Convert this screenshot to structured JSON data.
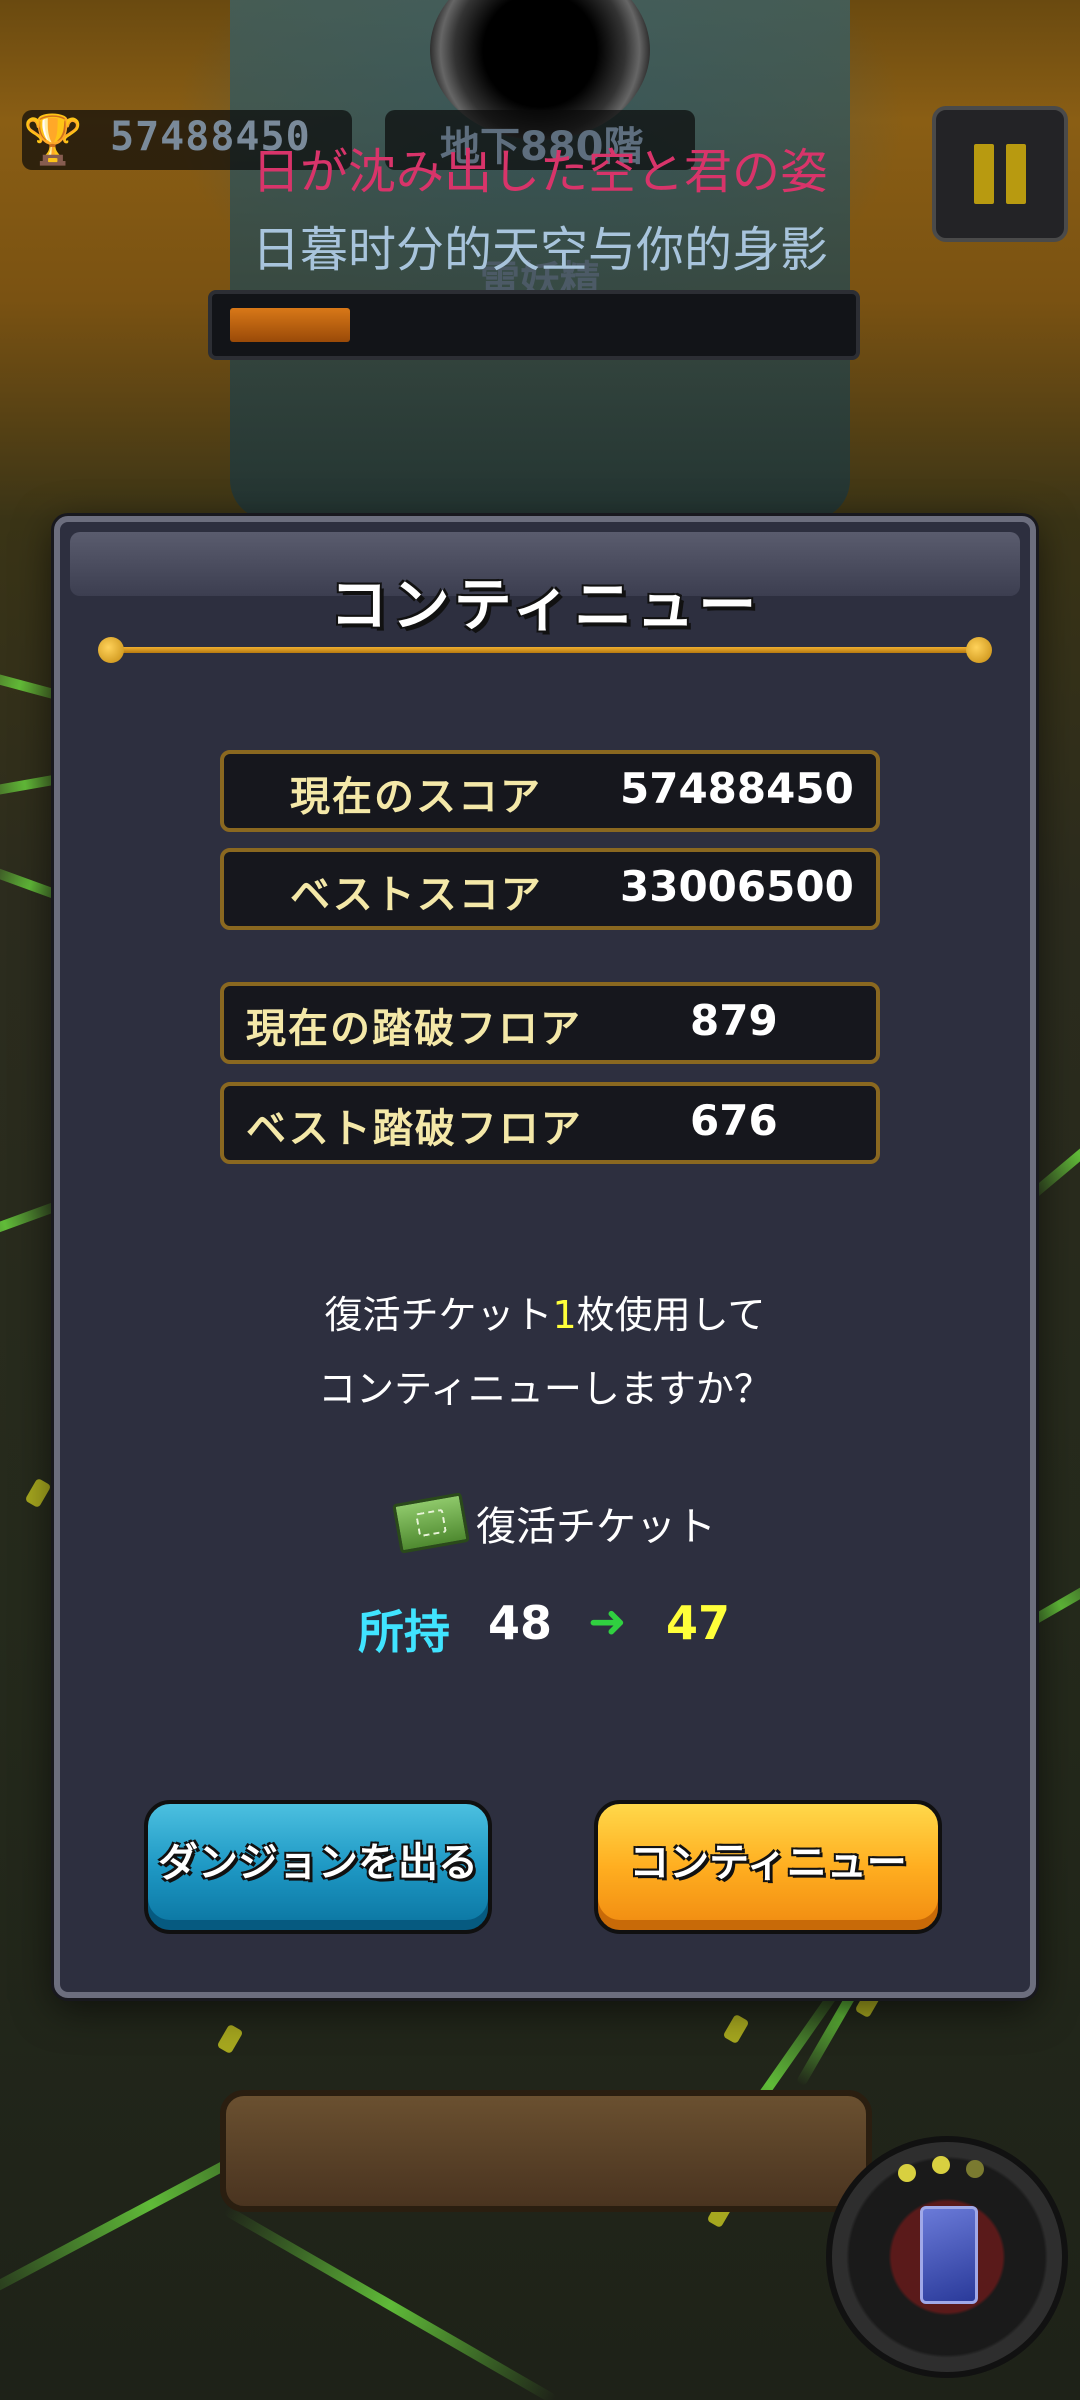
{
  "hud": {
    "current_score": "57488450",
    "floor": "地下880階",
    "trophy_icon": "trophy-icon",
    "pause_icon": "pause-icon"
  },
  "lyrics": {
    "japanese": "日が沈み出した空と君の姿",
    "chinese": "日暮时分的天空与你的身影"
  },
  "enemy": {
    "name": "雷妖精",
    "hp_fraction": 0.2
  },
  "dialog": {
    "title": "コンティニュー",
    "stats": [
      {
        "label": "現在のスコア",
        "value": "57488450"
      },
      {
        "label": "ベストスコア",
        "value": "33006500"
      },
      {
        "label": "現在の踏破フロア",
        "value": "879"
      },
      {
        "label": "ベスト踏破フロア",
        "value": "676"
      }
    ],
    "message": {
      "line1_prefix": "復活チケット",
      "line1_count": "1",
      "line1_suffix": "枚使用して",
      "line2": "コンティニューしますか？"
    },
    "ticket": {
      "icon": "ticket-icon",
      "label": "復活チケット"
    },
    "ownership": {
      "label": "所持",
      "from": "48",
      "arrow": "➜",
      "to": "47"
    },
    "buttons": {
      "leave": "ダンジョンを出る",
      "continue": "コンティニュー"
    }
  },
  "colors": {
    "dialog_bg": "#2d2f3f",
    "accent_gold": "#f0b030",
    "leave_button": "#1e98c4",
    "continue_button": "#ffae20",
    "own_label": "#40e4ff",
    "own_to": "#ffff3a",
    "arrow": "#30d040"
  }
}
